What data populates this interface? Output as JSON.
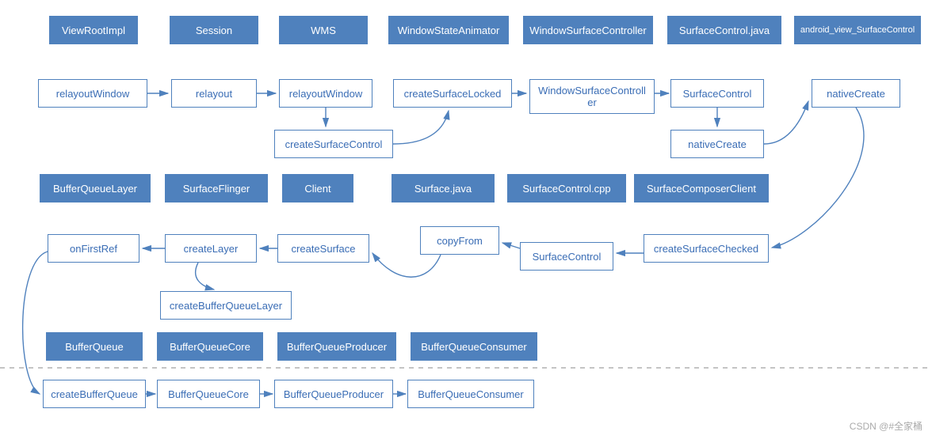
{
  "headers": {
    "viewRootImpl": "ViewRootImpl",
    "session": "Session",
    "wms": "WMS",
    "windowStateAnimator": "WindowStateAnimator",
    "windowSurfaceController": "WindowSurfaceController",
    "surfaceControlJava": "SurfaceControl.java",
    "androidViewSurfaceControl": "android_view_SurfaceControl",
    "bufferQueueLayer": "BufferQueueLayer",
    "surfaceFlinger": "SurfaceFlinger",
    "client": "Client",
    "surfaceJava": "Surface.java",
    "surfaceControlCpp": "SurfaceControl.cpp",
    "surfaceComposerClient": "SurfaceComposerClient",
    "bufferQueue": "BufferQueue",
    "bufferQueueCore": "BufferQueueCore",
    "bufferQueueProducer": "BufferQueueProducer",
    "bufferQueueConsumer": "BufferQueueConsumer"
  },
  "boxes": {
    "relayoutWindow1": "relayoutWindow",
    "relayout": "relayout",
    "relayoutWindow2": "relayoutWindow",
    "createSurfaceControl": "createSurfaceControl",
    "createSurfaceLocked": "createSurfaceLocked",
    "windowSurfaceCtrlBox": "WindowSurfaceControll\ner",
    "surfaceControlBox1": "SurfaceControl",
    "nativeCreateBox1": "nativeCreate",
    "nativeCreateBox2": "nativeCreate",
    "onFirstRef": "onFirstRef",
    "createLayer": "createLayer",
    "createBufferQueueLayer": "createBufferQueueLayer",
    "createSurface": "createSurface",
    "copyFrom": "copyFrom",
    "surfaceControlBox2": "SurfaceControl",
    "createSurfaceChecked": "createSurfaceChecked",
    "createBufferQueue": "createBufferQueue",
    "bufferQueueCoreBox": "BufferQueueCore",
    "bufferQueueProducerBox": "BufferQueueProducer",
    "bufferQueueConsumerBox": "BufferQueueConsumer"
  },
  "watermark": "CSDN @#全家桶"
}
